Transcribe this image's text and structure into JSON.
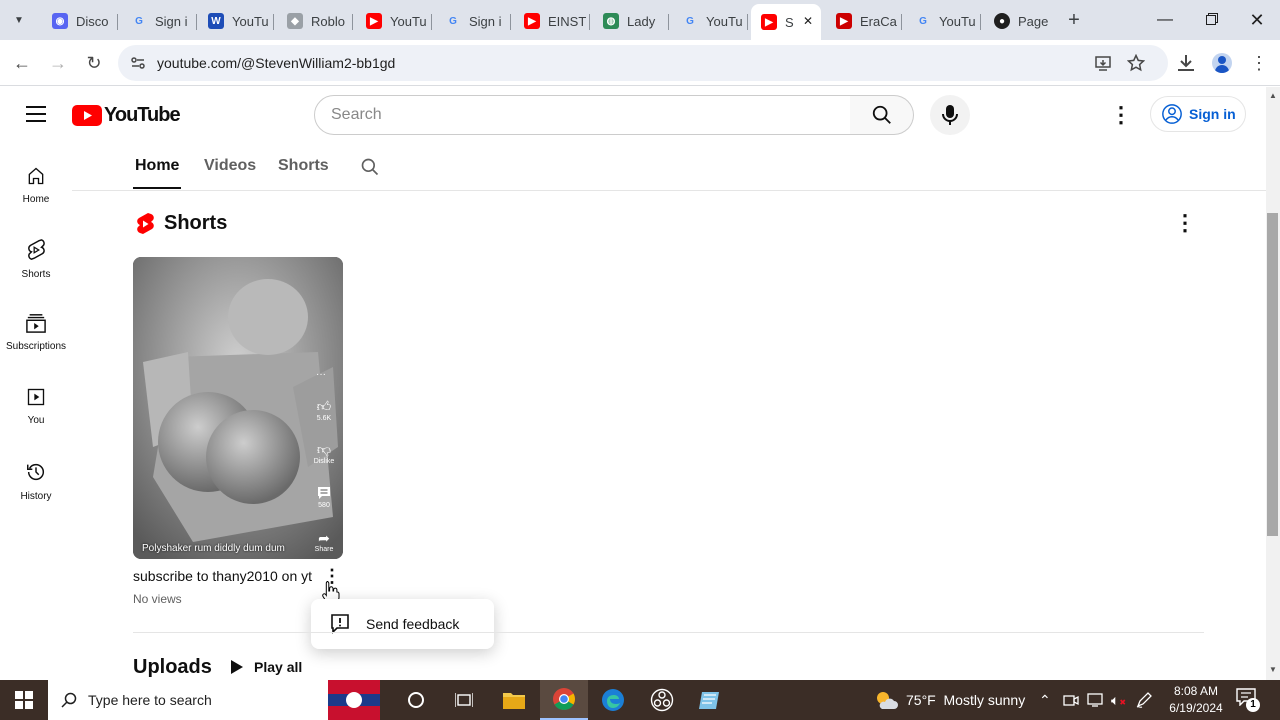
{
  "browser": {
    "tabs": [
      {
        "title": "Disco",
        "icon": "discord-icon",
        "color": "#5865f2"
      },
      {
        "title": "Sign i",
        "icon": "google-icon",
        "color": "#4285f4"
      },
      {
        "title": "YouTu",
        "icon": "w-icon",
        "color": "#1e4db7"
      },
      {
        "title": "Roblo",
        "icon": "roblox-icon",
        "color": "#9aa0a6"
      },
      {
        "title": "YouTu",
        "icon": "youtube-icon",
        "color": "#ff0000"
      },
      {
        "title": "Sign i",
        "icon": "google-icon",
        "color": "#4285f4"
      },
      {
        "title": "EINST",
        "icon": "youtube-icon",
        "color": "#ff0000"
      },
      {
        "title": "Lady",
        "icon": "earth-icon",
        "color": "#2e8b57"
      },
      {
        "title": "YouTu",
        "icon": "google-icon",
        "color": "#4285f4"
      },
      {
        "title": "S",
        "icon": "youtube-icon",
        "color": "#ff0000",
        "active": true
      },
      {
        "title": "EraCa",
        "icon": "youtube-icon",
        "color": "#cc0000"
      },
      {
        "title": "YouTu",
        "icon": "google-icon",
        "color": "#4285f4"
      },
      {
        "title": "Page",
        "icon": "github-icon",
        "color": "#1f1f1f"
      }
    ],
    "url": "youtube.com/@StevenWilliam2-bb1gd"
  },
  "youtube": {
    "logo_text": "YouTube",
    "search_placeholder": "Search",
    "signin_label": "Sign in",
    "sidebar": [
      {
        "label": "Home",
        "icon": "home-icon"
      },
      {
        "label": "Shorts",
        "icon": "shorts-icon"
      },
      {
        "label": "Subscriptions",
        "icon": "subscriptions-icon"
      },
      {
        "label": "You",
        "icon": "you-icon"
      },
      {
        "label": "History",
        "icon": "history-icon"
      }
    ],
    "channel_tabs": [
      "Home",
      "Videos",
      "Shorts"
    ],
    "shorts_section_title": "Shorts",
    "short": {
      "overlay_caption": "Polyshaker rum diddly dum dum",
      "likes": "5.6K",
      "dislike": "Dislike",
      "comments": "580",
      "share": "Share",
      "title": "subscribe to thany2010 on yt",
      "views": "No views"
    },
    "menu": {
      "send_feedback": "Send feedback"
    },
    "uploads_title": "Uploads",
    "play_all": "Play all"
  },
  "taskbar": {
    "search_placeholder": "Type here to search",
    "weather": "75°F  Mostly sunny",
    "time": "8:08 AM",
    "date": "6/19/2024",
    "notification_count": "1"
  }
}
